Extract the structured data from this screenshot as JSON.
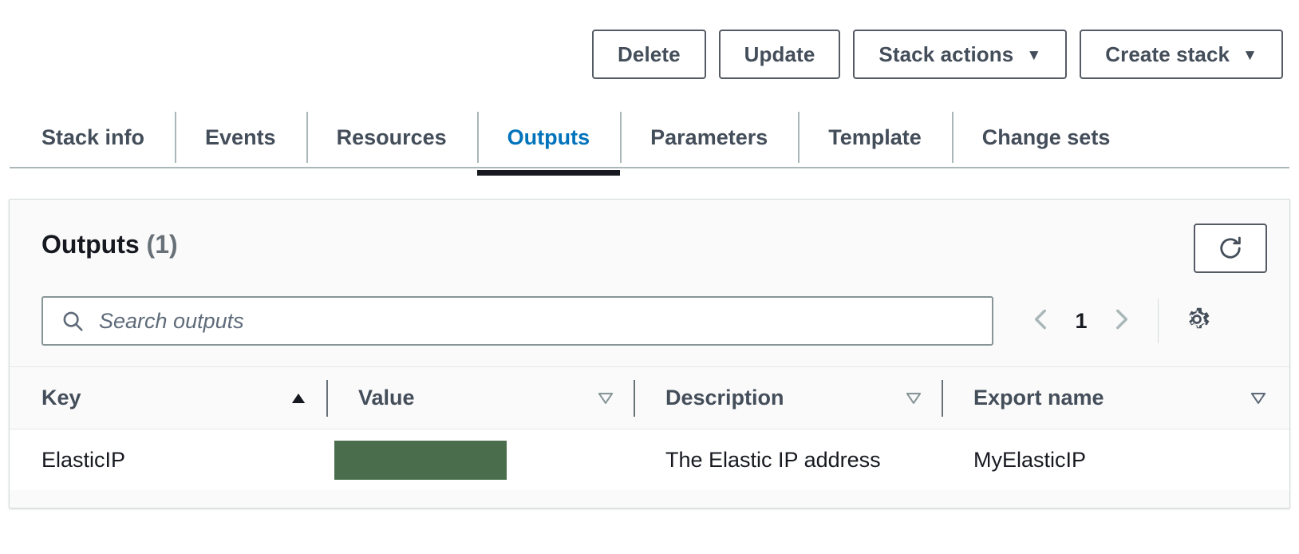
{
  "toolbar": {
    "buttons": [
      {
        "label": "Delete",
        "has_caret": false,
        "caret": ""
      },
      {
        "label": "Update",
        "has_caret": false,
        "caret": ""
      },
      {
        "label": "Stack actions",
        "has_caret": true,
        "caret": "▼"
      },
      {
        "label": "Create stack",
        "has_caret": true,
        "caret": "▼"
      }
    ]
  },
  "tabs": {
    "items": [
      {
        "label": "Stack info",
        "active": false
      },
      {
        "label": "Events",
        "active": false
      },
      {
        "label": "Resources",
        "active": false
      },
      {
        "label": "Outputs",
        "active": true
      },
      {
        "label": "Parameters",
        "active": false
      },
      {
        "label": "Template",
        "active": false
      },
      {
        "label": "Change sets",
        "active": false
      }
    ],
    "active_label": "Outputs",
    "active_color": "#0073bb",
    "inactive_color": "#444e5a"
  },
  "panel": {
    "title": "Outputs",
    "count": "(1)",
    "refresh_icon": "refresh-icon",
    "search": {
      "placeholder": "Search outputs",
      "value": "",
      "icon": "search-icon"
    },
    "pagination": {
      "prev_icon": "chevron-left-icon",
      "page": "1",
      "next_icon": "chevron-right-icon",
      "settings_icon": "gear-icon"
    }
  },
  "table": {
    "columns": [
      {
        "label": "Key",
        "sort": "asc",
        "sort_icon": "sort-ascending-filled-icon"
      },
      {
        "label": "Value",
        "sort": "none",
        "sort_icon": "sort-descending-outline-icon"
      },
      {
        "label": "Description",
        "sort": "none",
        "sort_icon": "sort-descending-outline-icon"
      },
      {
        "label": "Export name",
        "sort": "none",
        "sort_icon": "sort-descending-outline-icon"
      }
    ],
    "rows": [
      {
        "key": "ElasticIP",
        "value": "",
        "value_redacted": true,
        "description": "The Elastic IP address",
        "export_name": "MyElasticIP"
      }
    ]
  },
  "colors": {
    "accent_blue": "#0073bb",
    "text_dark": "#16191f",
    "text_muted": "#687078",
    "border": "#d5dbdb",
    "redaction_green": "#4a6e4b",
    "panel_bg": "#fafafa"
  }
}
